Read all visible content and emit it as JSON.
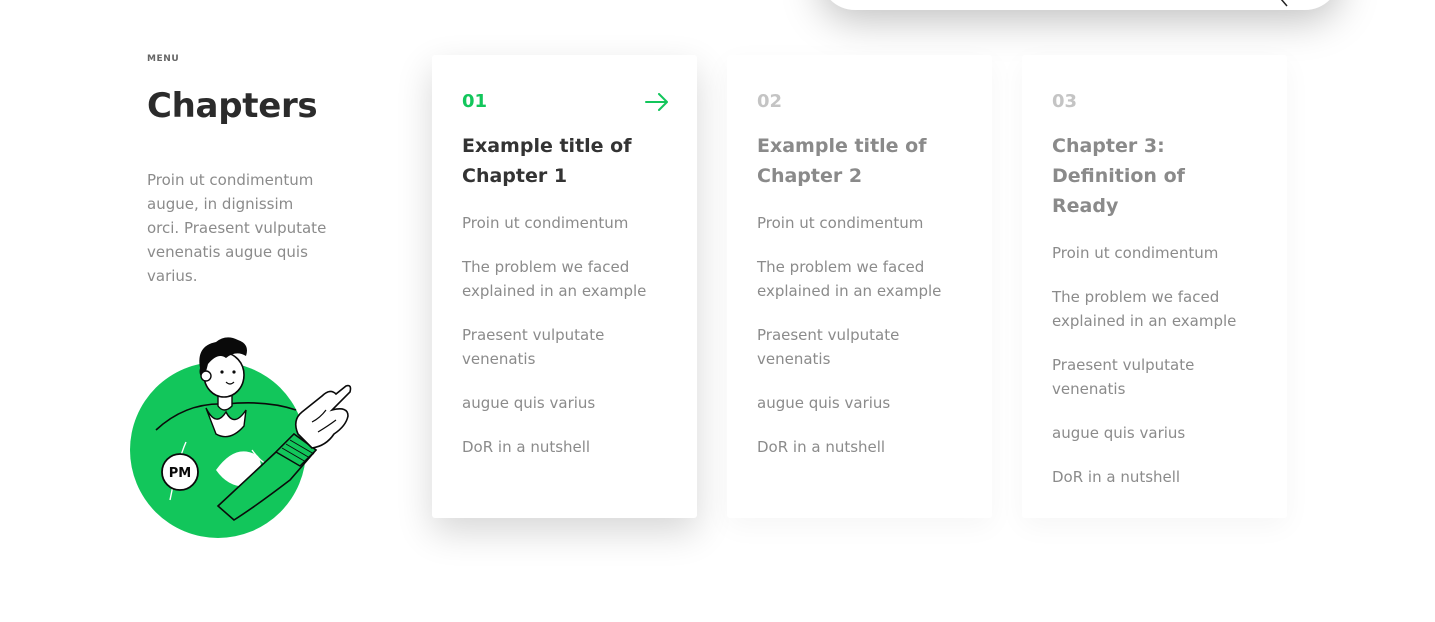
{
  "menu_label": "MENU",
  "title": "Chapters",
  "intro": "Proin ut condimentum augue, in dignissim orci. Praesent vulputate venenatis augue quis varius.",
  "illustration": {
    "badge_text": "PM",
    "accent_color": "#12c65b"
  },
  "colors": {
    "accent": "#12c65b",
    "muted_number": "#c4c4c4",
    "body_text": "#8b8b8b",
    "heading": "#333333"
  },
  "chapters": [
    {
      "number": "01",
      "title": "Example title of Chapter 1",
      "active": true,
      "items": [
        "Proin ut condimentum",
        "The problem we faced explained in an example",
        "Praesent vulputate venenatis",
        "augue quis varius",
        "DoR in a nutshell"
      ]
    },
    {
      "number": "02",
      "title": "Example title of Chapter 2",
      "active": false,
      "items": [
        "Proin ut condimentum",
        "The problem we faced explained in an example",
        "Praesent vulputate venenatis",
        "augue quis varius",
        "DoR in a nutshell"
      ]
    },
    {
      "number": "03",
      "title": "Chapter 3: Definition of Ready",
      "active": false,
      "items": [
        "Proin ut condimentum",
        "The problem we faced explained in an example",
        "Praesent vulputate venenatis",
        "augue quis varius",
        "DoR in a nutshell"
      ]
    }
  ]
}
